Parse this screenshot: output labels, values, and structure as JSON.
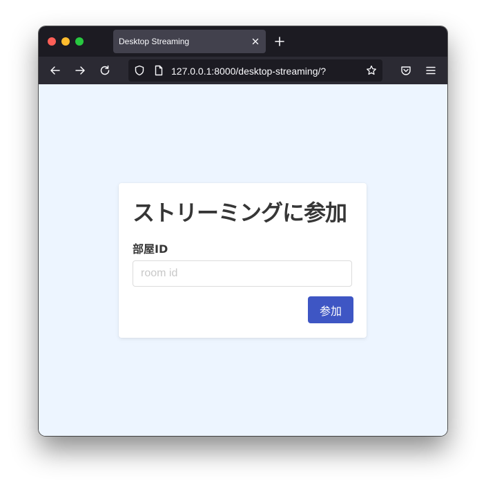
{
  "browser": {
    "tab": {
      "title": "Desktop Streaming"
    },
    "url": "127.0.0.1:8000/desktop-streaming/?"
  },
  "page": {
    "title": "ストリーミングに参加",
    "room_field": {
      "label": "部屋ID",
      "placeholder": "room id",
      "value": ""
    },
    "join_button_label": "参加"
  },
  "colors": {
    "page_background": "#edf5ff",
    "button": "#3e56c4",
    "titlebar": "#1c1b22",
    "navbar": "#2b2a33"
  }
}
